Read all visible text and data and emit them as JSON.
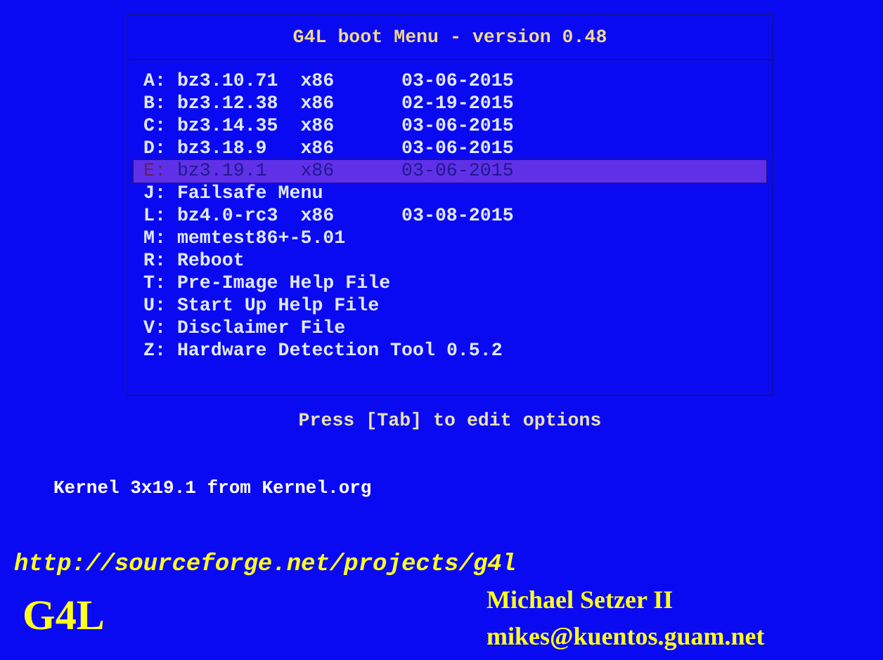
{
  "menu": {
    "title": "G4L boot Menu - version 0.48",
    "items": [
      {
        "key": "A:",
        "label": "bz3.10.71",
        "arch": "x86",
        "date": "03-06-2015",
        "selected": false
      },
      {
        "key": "B:",
        "label": "bz3.12.38",
        "arch": "x86",
        "date": "02-19-2015",
        "selected": false
      },
      {
        "key": "C:",
        "label": "bz3.14.35",
        "arch": "x86",
        "date": "03-06-2015",
        "selected": false
      },
      {
        "key": "D:",
        "label": "bz3.18.9",
        "arch": "x86",
        "date": "03-06-2015",
        "selected": false
      },
      {
        "key": "E:",
        "label": "bz3.19.1",
        "arch": "x86",
        "date": "03-06-2015",
        "selected": true
      },
      {
        "key": "J:",
        "label": "Failsafe Menu",
        "selected": false
      },
      {
        "key": "L:",
        "label": "bz4.0-rc3",
        "arch": "x86",
        "date": "03-08-2015",
        "selected": false
      },
      {
        "key": "M:",
        "label": "memtest86+-5.01",
        "selected": false
      },
      {
        "key": "R:",
        "label": "Reboot",
        "selected": false
      },
      {
        "key": "T:",
        "label": "Pre-Image Help File",
        "selected": false
      },
      {
        "key": "U:",
        "label": "Start Up Help File",
        "selected": false
      },
      {
        "key": "V:",
        "label": "Disclaimer File",
        "selected": false
      },
      {
        "key": "Z:",
        "label": "Hardware Detection Tool 0.5.2",
        "selected": false
      }
    ]
  },
  "help_text": "Press [Tab] to edit options",
  "kernel_note": "Kernel 3x19.1 from Kernel.org",
  "url": "http://sourceforge.net/projects/g4l",
  "logo": "G4L",
  "author": "Michael Setzer II",
  "email": "mikes@kuentos.guam.net"
}
